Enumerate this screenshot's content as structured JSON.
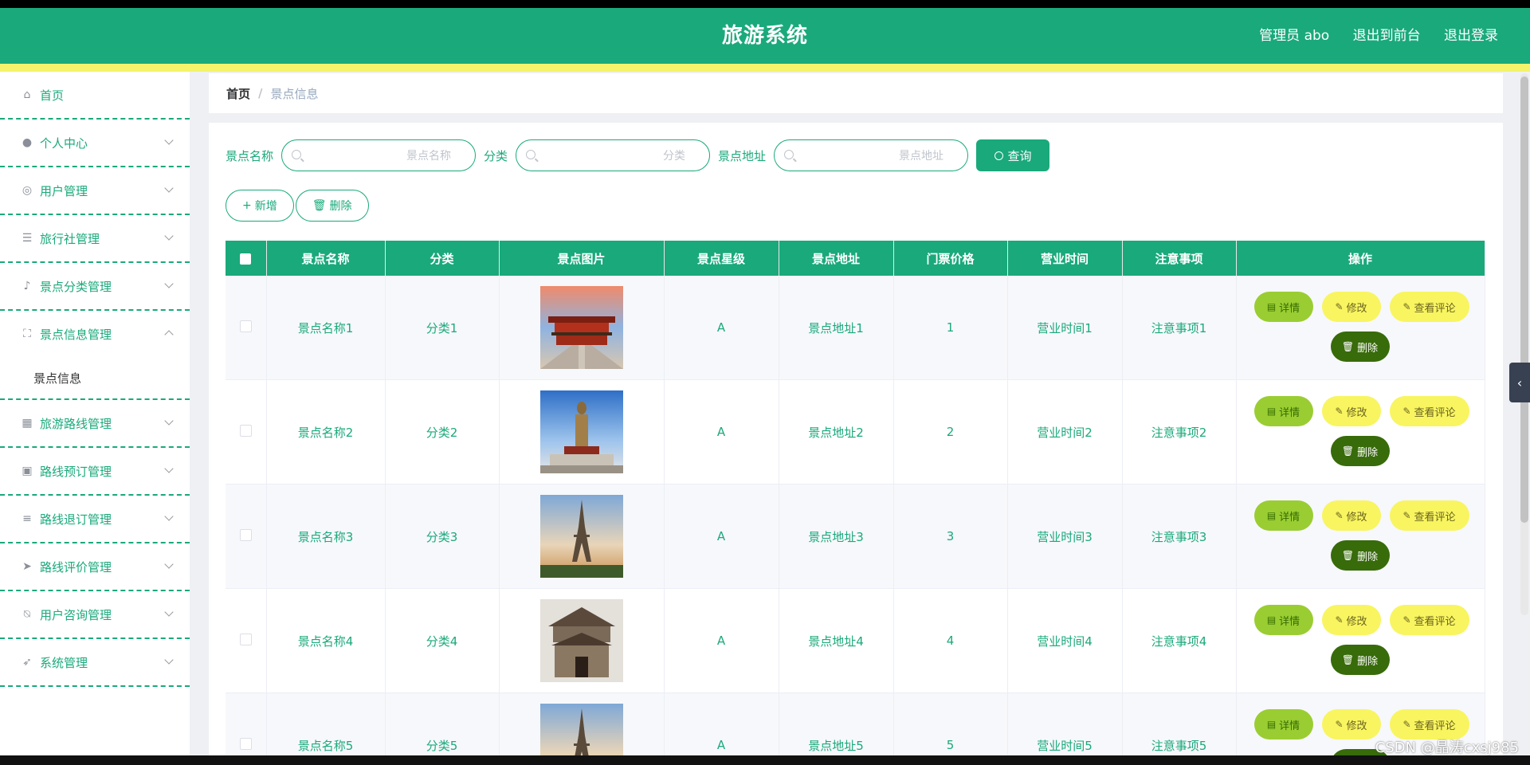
{
  "header": {
    "title": "旅游系统",
    "admin": "管理员 abo",
    "to_front": "退出到前台",
    "logout": "退出登录"
  },
  "sidebar": {
    "items": [
      {
        "label": "首页",
        "icon": "home-icon"
      },
      {
        "label": "个人中心",
        "icon": "user-icon"
      },
      {
        "label": "用户管理",
        "icon": "life-ring-icon"
      },
      {
        "label": "旅行社管理",
        "icon": "list-icon"
      },
      {
        "label": "景点分类管理",
        "icon": "microphone-icon"
      },
      {
        "label": "景点信息管理",
        "icon": "frame-icon",
        "expanded": true
      },
      {
        "label": "旅游路线管理",
        "icon": "grid-icon"
      },
      {
        "label": "路线预订管理",
        "icon": "clipboard-icon"
      },
      {
        "label": "路线退订管理",
        "icon": "sliders-icon"
      },
      {
        "label": "路线评价管理",
        "icon": "send-icon"
      },
      {
        "label": "用户咨询管理",
        "icon": "bell-off-icon"
      },
      {
        "label": "系统管理",
        "icon": "navigation-icon"
      }
    ],
    "sub_item": "景点信息"
  },
  "breadcrumb": {
    "home": "首页",
    "separator": "/",
    "current": "景点信息"
  },
  "search": {
    "name_label": "景点名称",
    "name_placeholder": "景点名称",
    "category_label": "分类",
    "category_placeholder": "分类",
    "address_label": "景点地址",
    "address_placeholder": "景点地址",
    "query_button": "查询"
  },
  "actions": {
    "add": "新增",
    "delete": "删除"
  },
  "table": {
    "headers": [
      "景点名称",
      "分类",
      "景点图片",
      "景点星级",
      "景点地址",
      "门票价格",
      "营业时间",
      "注意事项",
      "操作"
    ],
    "rows": [
      {
        "name": "景点名称1",
        "category": "分类1",
        "star": "A",
        "address": "景点地址1",
        "price": "1",
        "hours": "营业时间1",
        "notes": "注意事项1",
        "image": "palace"
      },
      {
        "name": "景点名称2",
        "category": "分类2",
        "star": "A",
        "address": "景点地址2",
        "price": "2",
        "hours": "营业时间2",
        "notes": "注意事项2",
        "image": "buddha"
      },
      {
        "name": "景点名称3",
        "category": "分类3",
        "star": "A",
        "address": "景点地址3",
        "price": "3",
        "hours": "营业时间3",
        "notes": "注意事项3",
        "image": "eiffel"
      },
      {
        "name": "景点名称4",
        "category": "分类4",
        "star": "A",
        "address": "景点地址4",
        "price": "4",
        "hours": "营业时间4",
        "notes": "注意事项4",
        "image": "temple"
      },
      {
        "name": "景点名称5",
        "category": "分类5",
        "star": "A",
        "address": "景点地址5",
        "price": "5",
        "hours": "营业时间5",
        "notes": "注意事项5",
        "image": "eiffel"
      }
    ],
    "ops": {
      "detail": "详情",
      "edit": "修改",
      "comments": "查看评论",
      "delete": "删除"
    }
  },
  "watermark": "CSDN @晶涛cxsj985",
  "colors": {
    "primary": "#1aa97b",
    "accent_yellow": "#f8f560",
    "detail_green": "#9acd32",
    "delete_dark": "#386b0a"
  }
}
